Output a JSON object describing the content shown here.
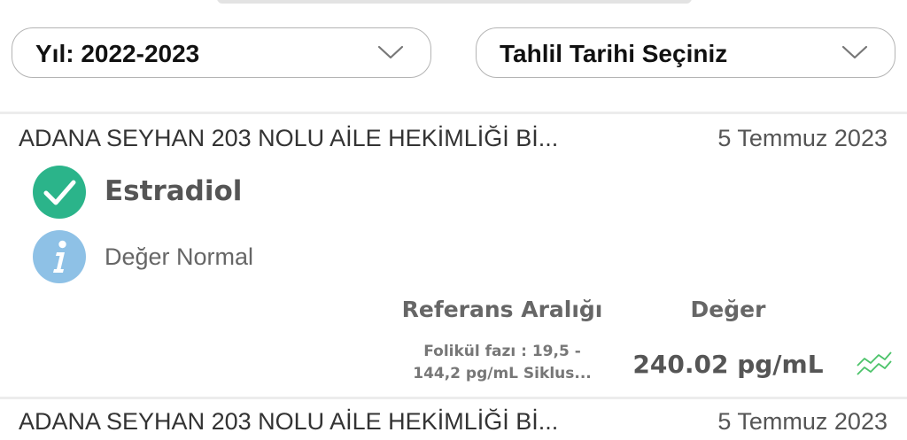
{
  "filters": {
    "year_label": "Yıl: 2022-2023",
    "date_label": "Tahlil Tarihi Seçiniz"
  },
  "results": [
    {
      "clinic": "ADANA SEYHAN 203 NOLU AİLE HEKİMLİĞİ Bİ...",
      "date": "5 Temmuz 2023",
      "test_name": "Estradiol",
      "status": "Değer Normal",
      "ref_header": "Referans Aralığı",
      "value_header": "Değer",
      "ref_line1": "Folikül fazı : 19,5 -",
      "ref_line2": "144,2 pg/mL Siklus...",
      "value": "240.02 pg/mL"
    },
    {
      "clinic": "ADANA SEYHAN 203 NOLU AİLE HEKİMLİĞİ Bİ...",
      "date": "5 Temmuz 2023"
    }
  ],
  "icons": {
    "check": "check-circle-icon",
    "info": "info-icon",
    "trend": "trend-chart-icon",
    "chevron": "chevron-down-icon"
  },
  "colors": {
    "check_green": "#2bb48a",
    "info_blue": "#8ec1e6",
    "trend_green": "#4cc36a"
  }
}
